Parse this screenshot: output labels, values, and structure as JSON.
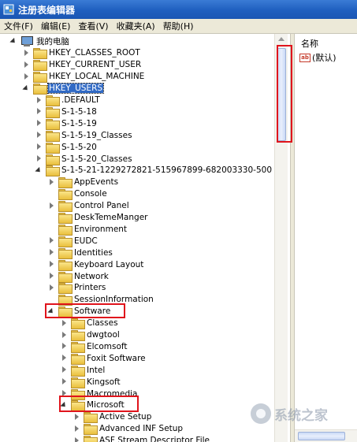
{
  "window": {
    "title": "注册表编辑器"
  },
  "menu": [
    "文件(F)",
    "编辑(E)",
    "查看(V)",
    "收藏夹(A)",
    "帮助(H)"
  ],
  "tree": [
    {
      "label": "我的电脑",
      "level": 0,
      "icon": "computer-icon",
      "expander": "expanded"
    },
    {
      "label": "HKEY_CLASSES_ROOT",
      "level": 1,
      "icon": "folder-icon",
      "expander": "collapsed"
    },
    {
      "label": "HKEY_CURRENT_USER",
      "level": 1,
      "icon": "folder-icon",
      "expander": "collapsed"
    },
    {
      "label": "HKEY_LOCAL_MACHINE",
      "level": 1,
      "icon": "folder-icon",
      "expander": "collapsed"
    },
    {
      "label": "HKEY_USERS",
      "level": 1,
      "icon": "folder-icon",
      "expander": "expanded",
      "selected": true
    },
    {
      "label": ".DEFAULT",
      "level": 2,
      "icon": "folder-icon",
      "expander": "collapsed"
    },
    {
      "label": "S-1-5-18",
      "level": 2,
      "icon": "folder-icon",
      "expander": "collapsed"
    },
    {
      "label": "S-1-5-19",
      "level": 2,
      "icon": "folder-icon",
      "expander": "collapsed"
    },
    {
      "label": "S-1-5-19_Classes",
      "level": 2,
      "icon": "folder-icon",
      "expander": "collapsed"
    },
    {
      "label": "S-1-5-20",
      "level": 2,
      "icon": "folder-icon",
      "expander": "collapsed"
    },
    {
      "label": "S-1-5-20_Classes",
      "level": 2,
      "icon": "folder-icon",
      "expander": "collapsed"
    },
    {
      "label": "S-1-5-21-1229272821-515967899-682003330-500",
      "level": 2,
      "icon": "folder-icon",
      "expander": "expanded"
    },
    {
      "label": "AppEvents",
      "level": 3,
      "icon": "folder-icon",
      "expander": "collapsed"
    },
    {
      "label": "Console",
      "level": 3,
      "icon": "folder-icon",
      "expander": "none"
    },
    {
      "label": "Control Panel",
      "level": 3,
      "icon": "folder-icon",
      "expander": "collapsed"
    },
    {
      "label": "DeskTemeManger",
      "level": 3,
      "icon": "folder-icon",
      "expander": "none"
    },
    {
      "label": "Environment",
      "level": 3,
      "icon": "folder-icon",
      "expander": "none"
    },
    {
      "label": "EUDC",
      "level": 3,
      "icon": "folder-icon",
      "expander": "collapsed"
    },
    {
      "label": "Identities",
      "level": 3,
      "icon": "folder-icon",
      "expander": "collapsed"
    },
    {
      "label": "Keyboard Layout",
      "level": 3,
      "icon": "folder-icon",
      "expander": "collapsed"
    },
    {
      "label": "Network",
      "level": 3,
      "icon": "folder-icon",
      "expander": "collapsed"
    },
    {
      "label": "Printers",
      "level": 3,
      "icon": "folder-icon",
      "expander": "collapsed"
    },
    {
      "label": "SessionInformation",
      "level": 3,
      "icon": "folder-icon",
      "expander": "none"
    },
    {
      "label": "Software",
      "level": 3,
      "icon": "folder-icon",
      "expander": "expanded"
    },
    {
      "label": "Classes",
      "level": 4,
      "icon": "folder-icon",
      "expander": "collapsed"
    },
    {
      "label": "dwgtool",
      "level": 4,
      "icon": "folder-icon",
      "expander": "collapsed"
    },
    {
      "label": "Elcomsoft",
      "level": 4,
      "icon": "folder-icon",
      "expander": "collapsed"
    },
    {
      "label": "Foxit Software",
      "level": 4,
      "icon": "folder-icon",
      "expander": "collapsed"
    },
    {
      "label": "Intel",
      "level": 4,
      "icon": "folder-icon",
      "expander": "collapsed"
    },
    {
      "label": "Kingsoft",
      "level": 4,
      "icon": "folder-icon",
      "expander": "collapsed"
    },
    {
      "label": "Macromedia",
      "level": 4,
      "icon": "folder-icon",
      "expander": "collapsed"
    },
    {
      "label": "Microsoft",
      "level": 4,
      "icon": "folder-icon",
      "expander": "expanded"
    },
    {
      "label": "Active Setup",
      "level": 5,
      "icon": "folder-icon",
      "expander": "collapsed"
    },
    {
      "label": "Advanced INF Setup",
      "level": 5,
      "icon": "folder-icon",
      "expander": "collapsed"
    },
    {
      "label": "ASF Stream Descriptor File",
      "level": 5,
      "icon": "folder-icon",
      "expander": "collapsed"
    }
  ],
  "values_pane": {
    "column_header": "名称",
    "rows": [
      {
        "icon": "string-value-icon",
        "name": "(默认)"
      }
    ]
  },
  "watermark": {
    "text": "系统之家"
  },
  "colors": {
    "highlight": "#e0141c",
    "selection": "#316ac5",
    "titlebar": "#1f5fbf"
  }
}
